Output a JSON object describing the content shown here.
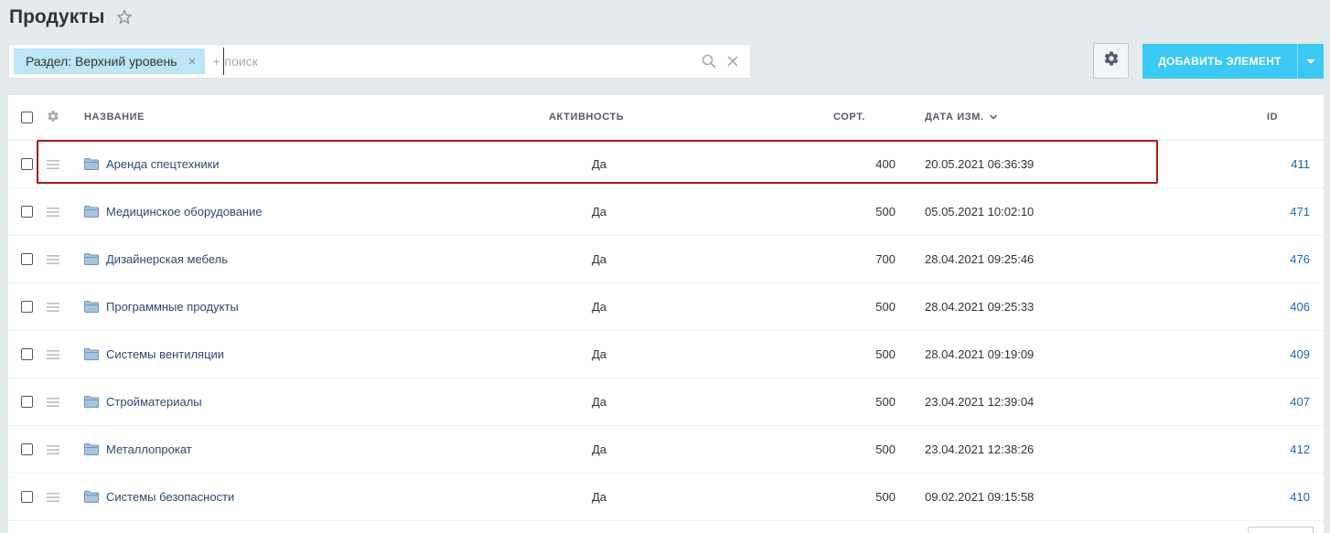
{
  "page": {
    "title": "Продукты"
  },
  "filter": {
    "chip_label": "Раздел: Верхний уровень",
    "add_symbol": "+",
    "search_placeholder": "поиск"
  },
  "toolbar": {
    "add_button_label": "ДОБАВИТЬ ЭЛЕМЕНТ"
  },
  "grid": {
    "columns": {
      "name": "НАЗВАНИЕ",
      "active": "АКТИВНОСТЬ",
      "sort": "СОРТ.",
      "date": "ДАТА ИЗМ.",
      "id": "ID"
    },
    "sorted_column": "date",
    "rows": [
      {
        "name": "Аренда спецтехники",
        "active": "Да",
        "sort": "400",
        "date": "20.05.2021 06:36:39",
        "id": "411",
        "highlighted": true
      },
      {
        "name": "Медицинское оборудование",
        "active": "Да",
        "sort": "500",
        "date": "05.05.2021 10:02:10",
        "id": "471"
      },
      {
        "name": "Дизайнерская мебель",
        "active": "Да",
        "sort": "700",
        "date": "28.04.2021 09:25:46",
        "id": "476"
      },
      {
        "name": "Программные продукты",
        "active": "Да",
        "sort": "500",
        "date": "28.04.2021 09:25:33",
        "id": "406"
      },
      {
        "name": "Системы вентиляции",
        "active": "Да",
        "sort": "500",
        "date": "28.04.2021 09:19:09",
        "id": "409"
      },
      {
        "name": "Стройматериалы",
        "active": "Да",
        "sort": "500",
        "date": "23.04.2021 12:39:04",
        "id": "407"
      },
      {
        "name": "Металлопрокат",
        "active": "Да",
        "sort": "500",
        "date": "23.04.2021 12:38:26",
        "id": "412"
      },
      {
        "name": "Системы безопасности",
        "active": "Да",
        "sort": "500",
        "date": "09.02.2021 09:15:58",
        "id": "410"
      }
    ]
  },
  "colors": {
    "accent": "#3bc8f5",
    "chip": "#bde6f7",
    "link": "#2067b0",
    "highlight": "#a31c1c"
  },
  "icons": {
    "star": "star-icon",
    "chip_close": "close-icon",
    "search": "search-icon",
    "clear": "clear-icon",
    "settings": "gear-icon",
    "dropdown": "chevron-down-icon",
    "drag": "drag-handle-icon",
    "folder": "folder-icon"
  }
}
